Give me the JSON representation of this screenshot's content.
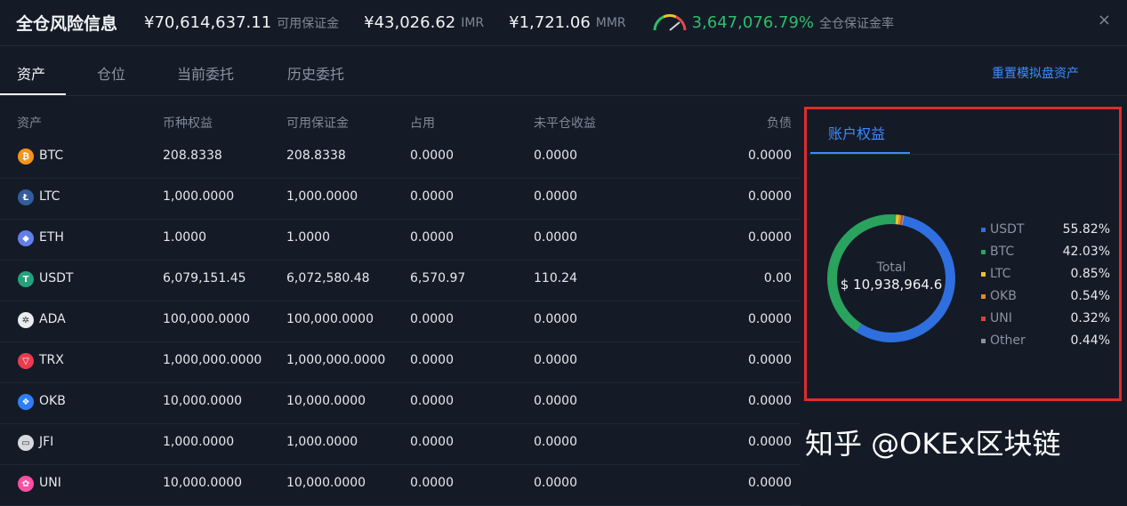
{
  "header": {
    "title": "全仓风险信息",
    "available_margin_value": "¥70,614,637.11",
    "available_margin_label": "可用保证金",
    "imr_value": "¥43,026.62",
    "imr_label": "IMR",
    "mmr_value": "¥1,721.06",
    "mmr_label": "MMR",
    "margin_ratio_value": "3,647,076.79%",
    "margin_ratio_label": "全仓保证金率",
    "close_icon": "×"
  },
  "tabs": [
    "资产",
    "仓位",
    "当前委托",
    "历史委托"
  ],
  "reset_label": "重置模拟盘资产",
  "table": {
    "headers": [
      "资产",
      "币种权益",
      "可用保证金",
      "占用",
      "未平仓收益",
      "负债"
    ],
    "rows": [
      {
        "coin": "BTC",
        "icon": "bitcoin-icon",
        "color": "#f7931a",
        "glyph": "₿",
        "equity": "208.8338",
        "available": "208.8338",
        "used": "0.0000",
        "upl": "0.0000",
        "liab": "0.0000"
      },
      {
        "coin": "LTC",
        "icon": "litecoin-icon",
        "color": "#345d9d",
        "glyph": "Ł",
        "equity": "1,000.0000",
        "available": "1,000.0000",
        "used": "0.0000",
        "upl": "0.0000",
        "liab": "0.0000"
      },
      {
        "coin": "ETH",
        "icon": "ethereum-icon",
        "color": "#627eea",
        "glyph": "◆",
        "equity": "1.0000",
        "available": "1.0000",
        "used": "0.0000",
        "upl": "0.0000",
        "liab": "0.0000"
      },
      {
        "coin": "USDT",
        "icon": "tether-icon",
        "color": "#26a17b",
        "glyph": "T",
        "equity": "6,079,151.45",
        "available": "6,072,580.48",
        "used": "6,570.97",
        "upl": "110.24",
        "liab": "0.00"
      },
      {
        "coin": "ADA",
        "icon": "cardano-icon",
        "color": "#e9ecef",
        "glyph": "✲",
        "equity": "100,000.0000",
        "available": "100,000.0000",
        "used": "0.0000",
        "upl": "0.0000",
        "liab": "0.0000"
      },
      {
        "coin": "TRX",
        "icon": "tron-icon",
        "color": "#eb3b4e",
        "glyph": "▽",
        "equity": "1,000,000.0000",
        "available": "1,000,000.0000",
        "used": "0.0000",
        "upl": "0.0000",
        "liab": "0.0000"
      },
      {
        "coin": "OKB",
        "icon": "okb-icon",
        "color": "#2d7ff9",
        "glyph": "❖",
        "equity": "10,000.0000",
        "available": "10,000.0000",
        "used": "0.0000",
        "upl": "0.0000",
        "liab": "0.0000"
      },
      {
        "coin": "JFI",
        "icon": "jfi-icon",
        "color": "#d6d9de",
        "glyph": "▭",
        "equity": "1,000.0000",
        "available": "1,000.0000",
        "used": "0.0000",
        "upl": "0.0000",
        "liab": "0.0000"
      },
      {
        "coin": "UNI",
        "icon": "uniswap-icon",
        "color": "#ff4fa3",
        "glyph": "✿",
        "equity": "10,000.0000",
        "available": "10,000.0000",
        "used": "0.0000",
        "upl": "0.0000",
        "liab": "0.0000"
      }
    ]
  },
  "panel": {
    "tab_label": "账户权益",
    "total_label": "Total",
    "total_value": "$ 10,938,964.6",
    "legend": [
      {
        "name": "USDT",
        "pct": "55.82%",
        "value": 55.82,
        "color": "#2f6fe0"
      },
      {
        "name": "BTC",
        "pct": "42.03%",
        "value": 42.03,
        "color": "#29a35e"
      },
      {
        "name": "LTC",
        "pct": "0.85%",
        "value": 0.85,
        "color": "#e8c52a"
      },
      {
        "name": "OKB",
        "pct": "0.54%",
        "value": 0.54,
        "color": "#e8892a"
      },
      {
        "name": "UNI",
        "pct": "0.32%",
        "value": 0.32,
        "color": "#d94432"
      },
      {
        "name": "Other",
        "pct": "0.44%",
        "value": 0.44,
        "color": "#8a93a1"
      }
    ]
  },
  "watermark": "知乎 @OKEx区块链"
}
